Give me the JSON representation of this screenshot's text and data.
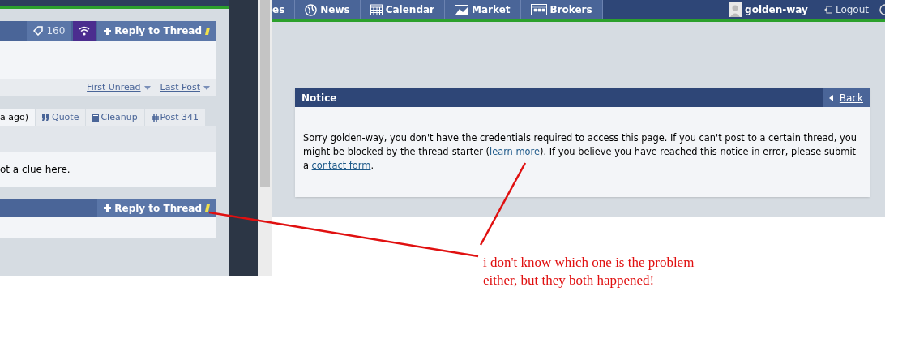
{
  "left_screen": {
    "thread_header": {
      "tag_count": "160",
      "reply_button": "Reply to Thread"
    },
    "thread_links": [
      "First Unread",
      "Last Post"
    ],
    "post": {
      "time_fragment": "a ago)",
      "actions": [
        {
          "kind": "quote",
          "label": "Quote"
        },
        {
          "kind": "cleanup",
          "label": "Cleanup"
        },
        {
          "kind": "post",
          "label": "Post 341"
        }
      ],
      "text_fragment": "ot a clue here."
    },
    "footer_reply_button": "Reply to Thread"
  },
  "right_screen": {
    "nav": {
      "items": [
        {
          "kind": "cut",
          "label": "es"
        },
        {
          "kind": "news",
          "label": "News"
        },
        {
          "kind": "calendar",
          "label": "Calendar"
        },
        {
          "kind": "market",
          "label": "Market"
        },
        {
          "kind": "brokers",
          "label": "Brokers"
        }
      ],
      "user": "golden-way",
      "logout": "Logout"
    },
    "notice": {
      "title": "Notice",
      "back": "Back",
      "parts": [
        {
          "kind": "text",
          "text": "Sorry golden-way, you don't have the credentials required to access this page. If you can't post to a certain thread, you might be blocked by the thread-starter ("
        },
        {
          "kind": "link",
          "text": "learn more"
        },
        {
          "kind": "text",
          "text": "). If you believe you have reached this notice in error, please submit a "
        },
        {
          "kind": "link",
          "text": "contact form"
        },
        {
          "kind": "text",
          "text": "."
        }
      ]
    }
  },
  "annotation": {
    "lines": [
      "i don't know which one is the problem",
      "either, but they both happened!"
    ]
  }
}
